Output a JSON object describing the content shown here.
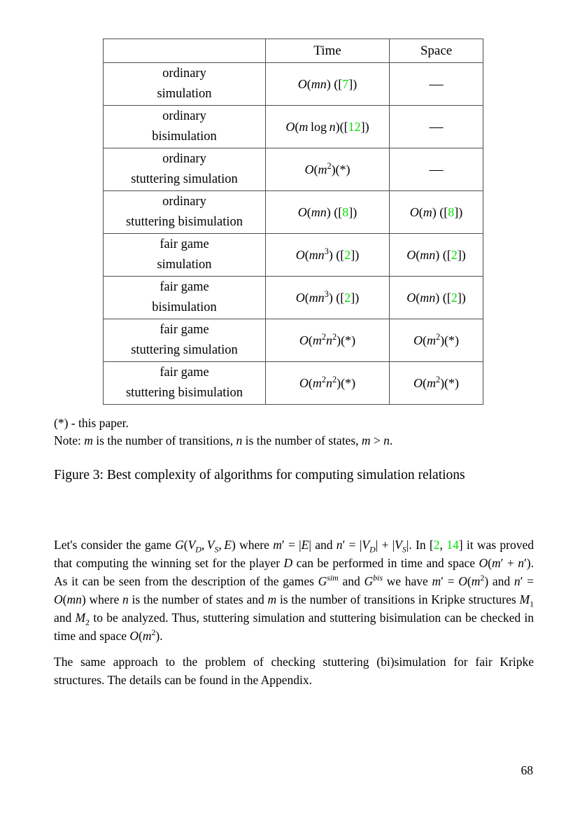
{
  "table": {
    "headers": [
      "",
      "Time",
      "Space"
    ],
    "rows": [
      {
        "label_line1": "ordinary",
        "label_line2": "simulation",
        "time": {
          "text": "O(mn) ([7])",
          "cite": "7"
        },
        "space": {
          "text": "—"
        }
      },
      {
        "label_line1": "ordinary",
        "label_line2": "bisimulation",
        "time": {
          "text": "O(m log n)([12])",
          "cite": "12"
        },
        "space": {
          "text": "—"
        }
      },
      {
        "label_line1": "ordinary",
        "label_line2": "stuttering simulation",
        "time": {
          "text": "O(m²)(*)",
          "cite": ""
        },
        "space": {
          "text": "—"
        }
      },
      {
        "label_line1": "ordinary",
        "label_line2": "stuttering bisimulation",
        "time": {
          "text": "O(mn) ([8])",
          "cite": "8"
        },
        "space": {
          "text": "O(m) ([8])",
          "cite": "8"
        }
      },
      {
        "label_line1": "fair game",
        "label_line2": "simulation",
        "time": {
          "text": "O(mn³) ([2])",
          "cite": "2"
        },
        "space": {
          "text": "O(mn) ([2])",
          "cite": "2"
        }
      },
      {
        "label_line1": "fair game",
        "label_line2": "bisimulation",
        "time": {
          "text": "O(mn³) ([2])",
          "cite": "2"
        },
        "space": {
          "text": "O(mn) ([2])",
          "cite": "2"
        }
      },
      {
        "label_line1": "fair game",
        "label_line2": "stuttering simulation",
        "time": {
          "text": "O(m²n²)(*)",
          "cite": ""
        },
        "space": {
          "text": "O(m²)(*)",
          "cite": ""
        }
      },
      {
        "label_line1": "fair game",
        "label_line2": "stuttering bisimulation",
        "time": {
          "text": "O(m²n²)(*)",
          "cite": ""
        },
        "space": {
          "text": "O(m²)(*)",
          "cite": ""
        }
      }
    ]
  },
  "notes": {
    "star_note": "(*) - this paper.",
    "note_line": "Note: m is the number of transitions, n is the number of states, m > n."
  },
  "caption": {
    "text": "Figure 3: Best complexity of algorithms for computing simulation relations",
    "label": "Figure 3:",
    "number": "3"
  },
  "paragraphs": {
    "p1": "Let's consider the game G(VD, VS, E) where m′ = |E| and n′ = |VD| + |VS|. In [2, 14] it was proved that computing the winning set for the player D can be performed in time and space O(m′ + n′). As it can be seen from the description of the games Gsim and Gbis we have m′ = O(m²) and n′ = O(mn) where n is the number of states and m is the number of transitions in Kripke structures M1 and M2 to be analyzed. Thus, stuttering simulation and stuttering bisimulation can be checked in time and space O(m²).",
    "p2": "The same approach to the problem of checking stuttering (bi)simulation for fair Kripke structures. The details can be found in the Appendix.",
    "citations_p1": [
      "2",
      "14"
    ]
  },
  "footer": {
    "page_number": "68"
  },
  "colors": {
    "citation_green": "#00e000",
    "text_black": "#000000",
    "table_border": "#4d4d4d"
  }
}
